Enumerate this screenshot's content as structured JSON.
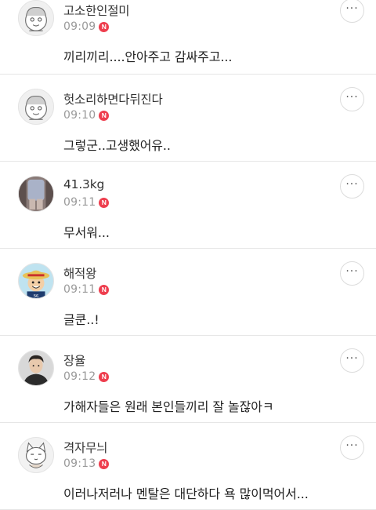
{
  "comments": [
    {
      "nickname": "고소한인절미",
      "time": "09:09",
      "badge": "N",
      "text": "끼리끼리....안아주고 감싸주고...",
      "more_icon": "more-dots-icon"
    },
    {
      "nickname": "헛소리하면다뒤진다",
      "time": "09:10",
      "badge": "N",
      "text": "그렇군..고생했어유..",
      "more_icon": "more-dots-icon"
    },
    {
      "nickname": "41.3kg",
      "time": "09:11",
      "badge": "N",
      "text": "무서워...",
      "more_icon": "more-dots-icon"
    },
    {
      "nickname": "해적왕",
      "time": "09:11",
      "badge": "N",
      "text": "글쿤..!",
      "more_icon": "more-dots-icon"
    },
    {
      "nickname": "장율",
      "time": "09:12",
      "badge": "N",
      "text": "가해자들은 원래 본인들끼리 잘 놀잖아ㅋ",
      "more_icon": "more-dots-icon"
    },
    {
      "nickname": "격자무늬",
      "time": "09:13",
      "badge": "N",
      "text": "이러나저러나 멘탈은 대단하다 욕 많이먹어서...",
      "more_icon": "more-dots-icon"
    }
  ],
  "colors": {
    "badge": "#ee3e4e",
    "time": "#9a9a9a",
    "divider": "#e6e6e6"
  },
  "more_label": "···"
}
